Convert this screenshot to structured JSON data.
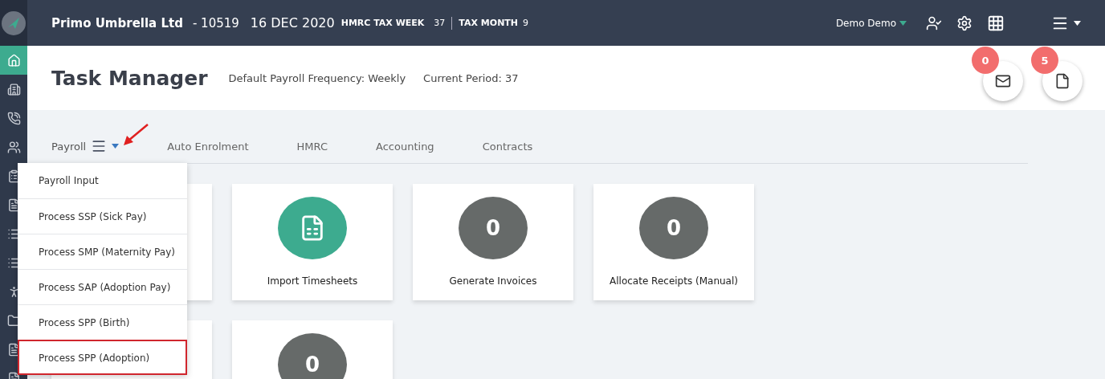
{
  "header": {
    "company": "Primo Umbrella Ltd",
    "code": "- 10519",
    "date": "16 DEC 2020",
    "tax_week_label": "HMRC TAX WEEK",
    "tax_week": "37",
    "tax_month_label": "TAX MONTH",
    "tax_month": "9",
    "user": "Demo Demo"
  },
  "sidebar": {
    "items": [
      {
        "selected": true
      },
      {
        "selected": false
      },
      {
        "selected": false
      },
      {
        "selected": false
      },
      {
        "selected": false
      },
      {
        "selected": false
      },
      {
        "selected": false
      },
      {
        "selected": false
      },
      {
        "selected": false
      },
      {
        "selected": false
      },
      {
        "selected": false
      },
      {
        "selected": false
      }
    ]
  },
  "page": {
    "title": "Task Manager",
    "frequency": "Default Payroll Frequency: Weekly",
    "period": "Current Period: 37"
  },
  "notifications": [
    {
      "count": "0"
    },
    {
      "count": "5"
    }
  ],
  "tabs": [
    {
      "label": "Payroll",
      "menu": true,
      "selected": true
    },
    {
      "label": "Auto Enrolment",
      "menu": false,
      "selected": false
    },
    {
      "label": "HMRC",
      "menu": false,
      "selected": false
    },
    {
      "label": "Accounting",
      "menu": false,
      "selected": false
    },
    {
      "label": "Contracts",
      "menu": false,
      "selected": false
    }
  ],
  "dropdown": {
    "items": [
      {
        "label": "Payroll Input",
        "highlighted": false
      },
      {
        "label": "Process SSP (Sick Pay)",
        "highlighted": false
      },
      {
        "label": "Process SMP (Maternity Pay)",
        "highlighted": false
      },
      {
        "label": "Process SAP (Adoption Pay)",
        "highlighted": false
      },
      {
        "label": "Process SPP (Birth)",
        "highlighted": false
      },
      {
        "label": "Process SPP (Adoption)",
        "highlighted": true
      }
    ]
  },
  "tasks": [
    {
      "kind": "blank"
    },
    {
      "kind": "icon",
      "label": "Import Timesheets"
    },
    {
      "kind": "count",
      "count": "0",
      "label": "Generate Invoices"
    },
    {
      "kind": "count",
      "count": "0",
      "label": "Allocate Receipts (Manual)"
    },
    {
      "kind": "blank"
    },
    {
      "kind": "count",
      "count": "0"
    }
  ]
}
